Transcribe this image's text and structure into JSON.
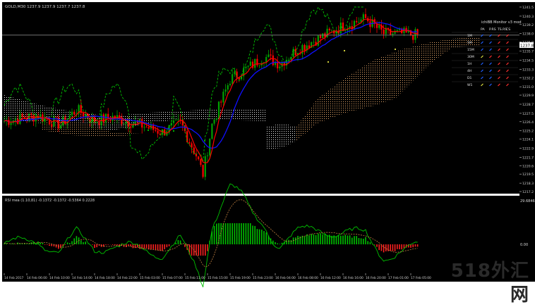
{
  "window": {
    "symbol_info": "GOLD,M30  1237.9 1237.9 1237.7 1237.8"
  },
  "price_panel": {
    "price_axis": [
      "1241.5",
      "1240.3",
      "1239.2",
      "1238.0",
      "1236.9",
      "1235.7",
      "1234.5",
      "1233.3",
      "1232.2",
      "1231.0",
      "1229.9",
      "1228.7",
      "1227.5",
      "1226.4",
      "1225.2",
      "1224.1",
      "1222.9",
      "1221.7",
      "1220.6",
      "1219.5",
      "1218.3",
      "1217.2"
    ],
    "current_price": "1237.8",
    "current_price_level": 1237.8
  },
  "monitor": {
    "title": "ichiBB Monitor v3 mod",
    "columns": [
      "PA",
      "P.RS",
      "TS.RS",
      "CS"
    ],
    "rows": [
      {
        "tf": "1M",
        "cells": [
          "blue",
          "blue",
          "red",
          "red"
        ]
      },
      {
        "tf": "5M",
        "cells": [
          "blue",
          "blue",
          "red",
          "red"
        ]
      },
      {
        "tf": "15M",
        "cells": [
          "blue",
          "blue",
          "red",
          "red"
        ]
      },
      {
        "tf": "30M",
        "cells": [
          "yellow",
          "red",
          "red",
          "red"
        ]
      },
      {
        "tf": "1H",
        "cells": [
          "blue",
          "blue",
          "red",
          "red"
        ]
      },
      {
        "tf": "4H",
        "cells": [
          "blue",
          "blue",
          "red",
          "red"
        ]
      },
      {
        "tf": "D1",
        "cells": [
          "blue",
          "blue",
          "red",
          "red"
        ]
      },
      {
        "tf": "W1",
        "cells": [
          "yellow",
          "blue",
          "red",
          "red"
        ]
      }
    ]
  },
  "indicator_panel": {
    "label": "RSI mea (1.10,81)  -0.1372  -0.1372  -0.5364  0.2228",
    "axis_top": "29.6846",
    "axis_zero": "0.00"
  },
  "time_axis": [
    "14 Feb 2017",
    "14 Feb 06:00",
    "14 Feb 10:00",
    "14 Feb 14:00",
    "14 Feb 18:00",
    "14 Feb 22:00",
    "15 Feb 03:00",
    "15 Feb 07:00",
    "15 Feb 11:00",
    "15 Feb 15:00",
    "15 Feb 19:00",
    "15 Feb 23:00",
    "16 Feb 04:00",
    "16 Feb 08:00",
    "16 Feb 12:00",
    "16 Feb 16:00",
    "16 Feb 20:00",
    "17 Feb 01:00",
    "17 Feb 05:00"
  ],
  "watermark": "518外汇网",
  "colors": {
    "background": "#000000",
    "frame": "#ffffff",
    "bull_candle": "#00a000",
    "bear_candle": "#ff0000",
    "tenkan": "#ff0000",
    "kijun": "#1010ff",
    "chikou": "#00c000",
    "kumo_bull": "#ffffff",
    "kumo_bear": "#f0b070",
    "hist_pos": "#00c000",
    "hist_neg": "#ff2020",
    "signal": "#c08040"
  }
}
